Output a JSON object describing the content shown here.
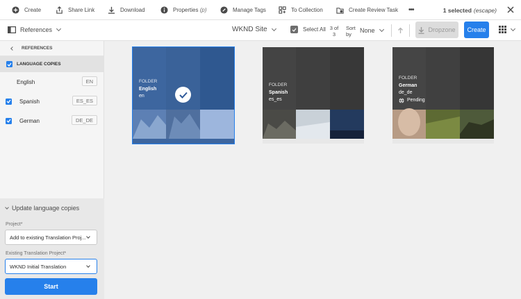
{
  "toolbar": {
    "create": "Create",
    "share_link": "Share Link",
    "download": "Download",
    "properties": "Properties",
    "properties_shortcut": "(p)",
    "manage_tags": "Manage Tags",
    "to_collection": "To Collection",
    "create_review_task": "Create Review Task",
    "more": "•••",
    "selected": "1 selected",
    "escape": "(escape)"
  },
  "bar2": {
    "rail_label": "References",
    "site": "WKND Site",
    "select_all": "Select All",
    "count_line1": "3 of",
    "count_line2": "3",
    "sort_line1": "Sort",
    "sort_line2": "by",
    "sort_value": "None",
    "dropzone": "Dropzone",
    "create": "Create"
  },
  "rail": {
    "header": "REFERENCES",
    "language_copies": "LANGUAGE COPIES",
    "languages": [
      {
        "name": "English",
        "code": "EN",
        "checked": false
      },
      {
        "name": "Spanish",
        "code": "ES_ES",
        "checked": true
      },
      {
        "name": "German",
        "code": "DE_DE",
        "checked": true
      }
    ],
    "update": {
      "title": "Update language copies",
      "project_label": "Project*",
      "project_value": "Add to existing Translation Proj...",
      "existing_label": "Existing Translation Project*",
      "existing_value": "WKND Initial Translation",
      "start": "Start"
    }
  },
  "cards": [
    {
      "type": "FOLDER",
      "name": "English",
      "code": "en",
      "status": "",
      "selected": true
    },
    {
      "type": "FOLDER",
      "name": "Spanish",
      "code": "es_es",
      "status": "",
      "selected": false
    },
    {
      "type": "FOLDER",
      "name": "German",
      "code": "de_de",
      "status": "Pending",
      "selected": false
    }
  ],
  "colors": {
    "accent": "#2680eb",
    "selected_overlay": "#2f5a9a"
  }
}
